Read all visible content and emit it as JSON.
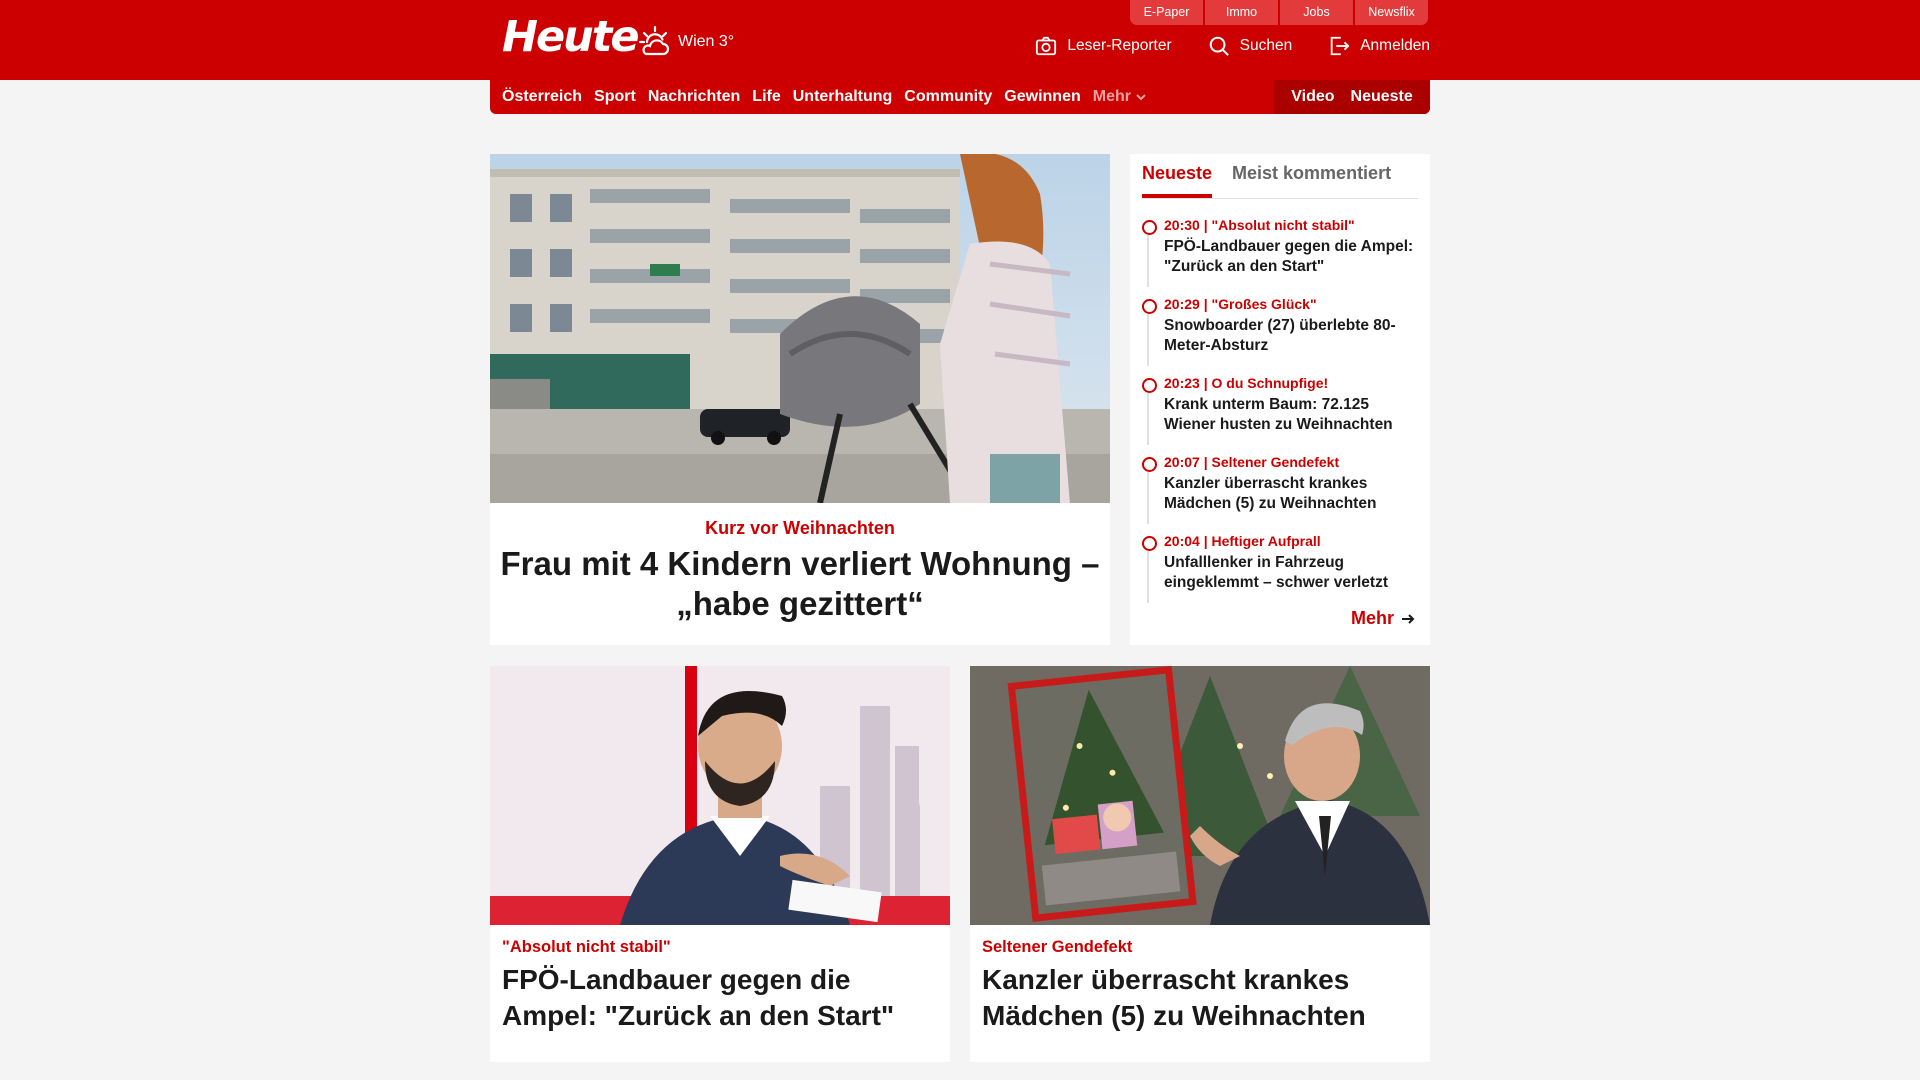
{
  "header": {
    "logo": "Heute",
    "weather": "Wien 3°",
    "services": [
      "E-Paper",
      "Immo",
      "Jobs",
      "Newsflix"
    ],
    "actions": {
      "reporter": "Leser-Reporter",
      "search": "Suchen",
      "login": "Anmelden"
    },
    "colors": {
      "brand": "#cc0000",
      "brand_dark": "#ab0000"
    }
  },
  "nav": {
    "items": [
      "Österreich",
      "Sport",
      "Nachrichten",
      "Life",
      "Unterhaltung",
      "Community",
      "Gewinnen"
    ],
    "more": "Mehr",
    "video": "Video",
    "newest": "Neueste"
  },
  "hero": {
    "kicker": "Kurz vor Weihnachten",
    "title": "Frau mit 4 Kindern verliert Wohnung – „habe gezittert“"
  },
  "sidebar": {
    "tabs": [
      "Neueste",
      "Meist kommentiert"
    ],
    "items": [
      {
        "meta": "20:30 | \"Absolut nicht stabil\"",
        "title": "FPÖ-Landbauer gegen die Ampel: \"Zurück an den Start\""
      },
      {
        "meta": "20:29 | \"Großes Glück\"",
        "title": "Snowboarder (27) überlebte 80-Meter-Absturz"
      },
      {
        "meta": "20:23 | O du Schnupfige!",
        "title": "Krank unterm Baum: 72.125 Wiener husten zu Weihnachten"
      },
      {
        "meta": "20:07 | Seltener Gendefekt",
        "title": "Kanzler überrascht krankes Mädchen (5) zu Weihnachten"
      },
      {
        "meta": "20:04 | Heftiger Aufprall",
        "title": "Unfalllenker in Fahrzeug eingeklemmt – schwer verletzt"
      }
    ],
    "more": "Mehr"
  },
  "cards": [
    {
      "kicker": "\"Absolut nicht stabil\"",
      "title": "FPÖ-Landbauer gegen die Ampel: \"Zurück an den Start\""
    },
    {
      "kicker": "Seltener Gendefekt",
      "title": "Kanzler überrascht krankes Mädchen (5) zu Weihnachten"
    }
  ]
}
